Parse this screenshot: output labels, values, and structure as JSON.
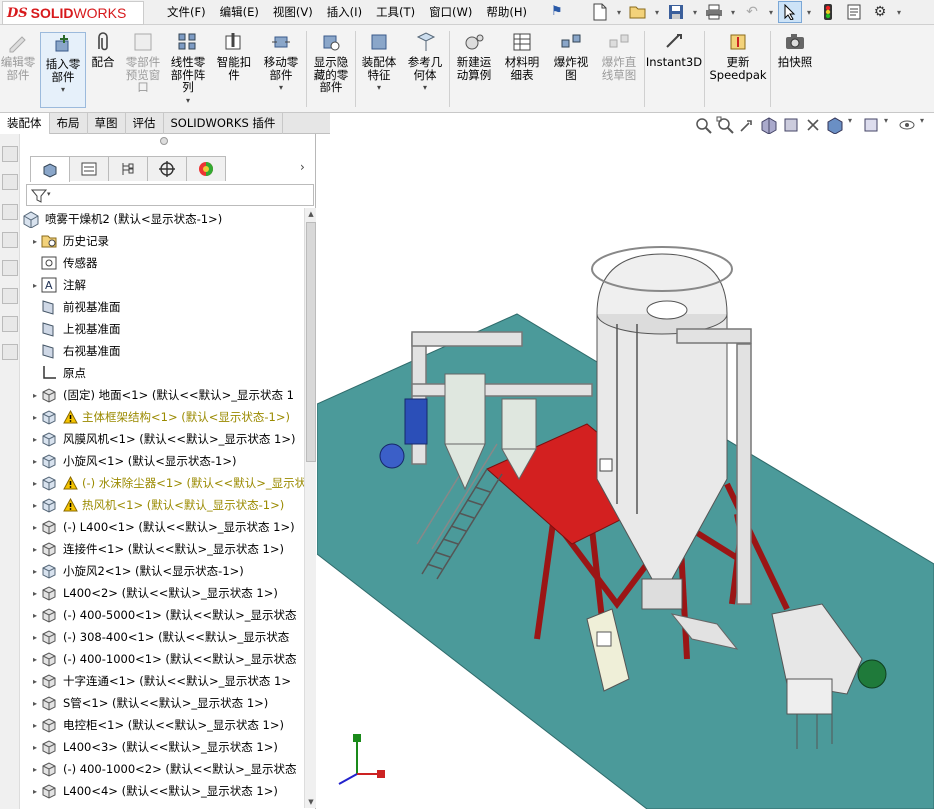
{
  "app": {
    "logo_ds": "DS",
    "logo_solid": "SOLID",
    "logo_works": "WORKS"
  },
  "menu": [
    "文件(F)",
    "编辑(E)",
    "视图(V)",
    "插入(I)",
    "工具(T)",
    "窗口(W)",
    "帮助(H)"
  ],
  "ribbon": {
    "items": [
      {
        "label": "编辑零\n部件",
        "disabled": true
      },
      {
        "label": "插入零\n部件",
        "disabled": false
      },
      {
        "label": "配合",
        "disabled": false
      },
      {
        "label": "零部件\n预览窗\n口",
        "disabled": true
      },
      {
        "label": "线性零\n部件阵\n列",
        "disabled": false
      },
      {
        "label": "智能扣\n件",
        "disabled": false
      },
      {
        "label": "移动零\n部件",
        "disabled": false
      },
      {
        "label": "显示隐\n藏的零\n部件",
        "disabled": false
      },
      {
        "label": "装配体\n特征",
        "disabled": false
      },
      {
        "label": "参考几\n何体",
        "disabled": false
      },
      {
        "label": "新建运\n动算例",
        "disabled": false
      },
      {
        "label": "材料明\n细表",
        "disabled": false
      },
      {
        "label": "爆炸视\n图",
        "disabled": false
      },
      {
        "label": "爆炸直\n线草图",
        "disabled": true
      },
      {
        "label": "Instant3D",
        "disabled": false
      },
      {
        "label": "更新\nSpeedpak",
        "disabled": false
      },
      {
        "label": "拍快照",
        "disabled": false
      }
    ]
  },
  "cm_tabs": [
    "装配体",
    "布局",
    "草图",
    "评估",
    "SOLIDWORKS 插件"
  ],
  "tree": {
    "root": "喷雾干燥机2 (默认<显示状态-1>)",
    "items": [
      {
        "label": "历史记录",
        "icon": "history-folder-icon",
        "exp": true,
        "warn": false
      },
      {
        "label": "传感器",
        "icon": "sensor-icon",
        "exp": false,
        "warn": false
      },
      {
        "label": "注解",
        "icon": "annotation-icon",
        "exp": true,
        "warn": false
      },
      {
        "label": "前视基准面",
        "icon": "plane-icon",
        "exp": false,
        "warn": false
      },
      {
        "label": "上视基准面",
        "icon": "plane-icon",
        "exp": false,
        "warn": false
      },
      {
        "label": "右视基准面",
        "icon": "plane-icon",
        "exp": false,
        "warn": false
      },
      {
        "label": "原点",
        "icon": "origin-icon",
        "exp": false,
        "warn": false
      },
      {
        "label": "(固定) 地面<1> (默认<<默认>_显示状态 1",
        "icon": "part-icon",
        "exp": true,
        "warn": false
      },
      {
        "label": "主体框架结构<1> (默认<显示状态-1>)",
        "icon": "assembly-icon",
        "exp": true,
        "warn": true
      },
      {
        "label": "风膜风机<1> (默认<<默认>_显示状态 1>)",
        "icon": "assembly-icon",
        "exp": true,
        "warn": false
      },
      {
        "label": "小旋风<1> (默认<显示状态-1>)",
        "icon": "assembly-icon",
        "exp": true,
        "warn": false
      },
      {
        "label": "(-) 水沫除尘器<1> (默认<<默认>_显示状",
        "icon": "assembly-icon",
        "exp": true,
        "warn": true
      },
      {
        "label": "热风机<1> (默认<默认_显示状态-1>)",
        "icon": "assembly-icon",
        "exp": true,
        "warn": true
      },
      {
        "label": "(-) L400<1> (默认<<默认>_显示状态 1>)",
        "icon": "part-icon",
        "exp": true,
        "warn": false
      },
      {
        "label": "连接件<1> (默认<<默认>_显示状态 1>)",
        "icon": "part-icon",
        "exp": true,
        "warn": false
      },
      {
        "label": "小旋风2<1> (默认<显示状态-1>)",
        "icon": "assembly-icon",
        "exp": true,
        "warn": false
      },
      {
        "label": "L400<2> (默认<<默认>_显示状态 1>)",
        "icon": "part-icon",
        "exp": true,
        "warn": false
      },
      {
        "label": "(-) 400-5000<1> (默认<<默认>_显示状态",
        "icon": "part-icon",
        "exp": true,
        "warn": false
      },
      {
        "label": "(-) 308-400<1> (默认<<默认>_显示状态",
        "icon": "part-icon",
        "exp": true,
        "warn": false
      },
      {
        "label": "(-) 400-1000<1> (默认<<默认>_显示状态",
        "icon": "part-icon",
        "exp": true,
        "warn": false
      },
      {
        "label": "十字连通<1> (默认<<默认>_显示状态 1>",
        "icon": "part-icon",
        "exp": true,
        "warn": false
      },
      {
        "label": "S管<1> (默认<<默认>_显示状态 1>)",
        "icon": "part-icon",
        "exp": true,
        "warn": false
      },
      {
        "label": "电控柜<1> (默认<<默认>_显示状态 1>)",
        "icon": "part-icon",
        "exp": true,
        "warn": false
      },
      {
        "label": "L400<3> (默认<<默认>_显示状态 1>)",
        "icon": "part-icon",
        "exp": true,
        "warn": false
      },
      {
        "label": "(-) 400-1000<2> (默认<<默认>_显示状态",
        "icon": "part-icon",
        "exp": true,
        "warn": false
      },
      {
        "label": "L400<4> (默认<<默认>_显示状态 1>)",
        "icon": "part-icon",
        "exp": true,
        "warn": false
      }
    ]
  },
  "colors": {
    "floor": "#4b9a9a",
    "platform": "#d32020",
    "frame": "#9b1515",
    "equipment": "#e9e9e9",
    "accent": "#d7191c"
  }
}
